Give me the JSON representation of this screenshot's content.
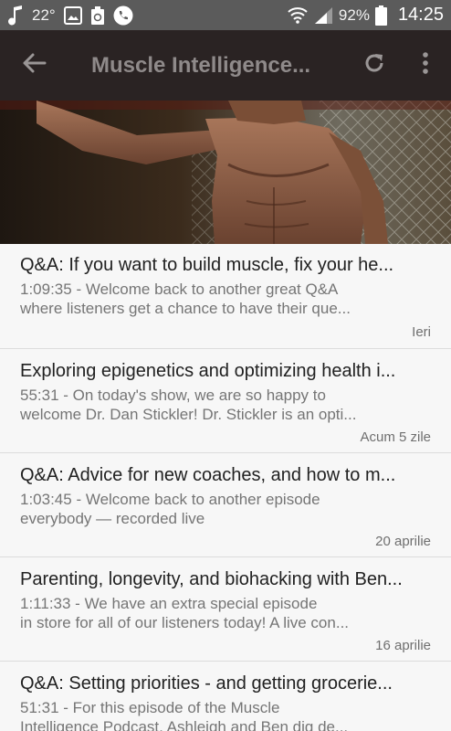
{
  "status_bar": {
    "temperature": "22°",
    "battery": "92%",
    "time": "14:25"
  },
  "toolbar": {
    "title": "Muscle Intelligence...",
    "back_icon": "arrow-back-icon",
    "refresh_icon": "refresh-icon",
    "menu_icon": "more-vert-icon"
  },
  "episodes": [
    {
      "title": "Q&A: If you want to build muscle, fix your he...",
      "desc_line1": "1:09:35 - Welcome back to another great Q&A",
      "desc_line2": "where listeners get a chance to have their que...",
      "date": "Ieri"
    },
    {
      "title": "Exploring epigenetics and optimizing health i...",
      "desc_line1": "55:31 - On today's show, we are so happy to",
      "desc_line2": "welcome Dr. Dan Stickler! Dr. Stickler is an opti...",
      "date": "Acum 5 zile"
    },
    {
      "title": "Q&A: Advice for new coaches, and how to m...",
      "desc_line1": "1:03:45 - Welcome back to another episode",
      "desc_line2": "everybody — recorded live",
      "date": "20 aprilie"
    },
    {
      "title": "Parenting, longevity, and biohacking with Ben...",
      "desc_line1": "1:11:33 - We have an extra special episode",
      "desc_line2": "in store for all of our listeners today! A live con...",
      "date": "16 aprilie"
    },
    {
      "title": "Q&A: Setting priorities - and getting grocerie...",
      "desc_line1": "51:31 - For this episode of the Muscle",
      "desc_line2": "Intelligence Podcast, Ashleigh and Ben dig de...",
      "date": ""
    }
  ]
}
